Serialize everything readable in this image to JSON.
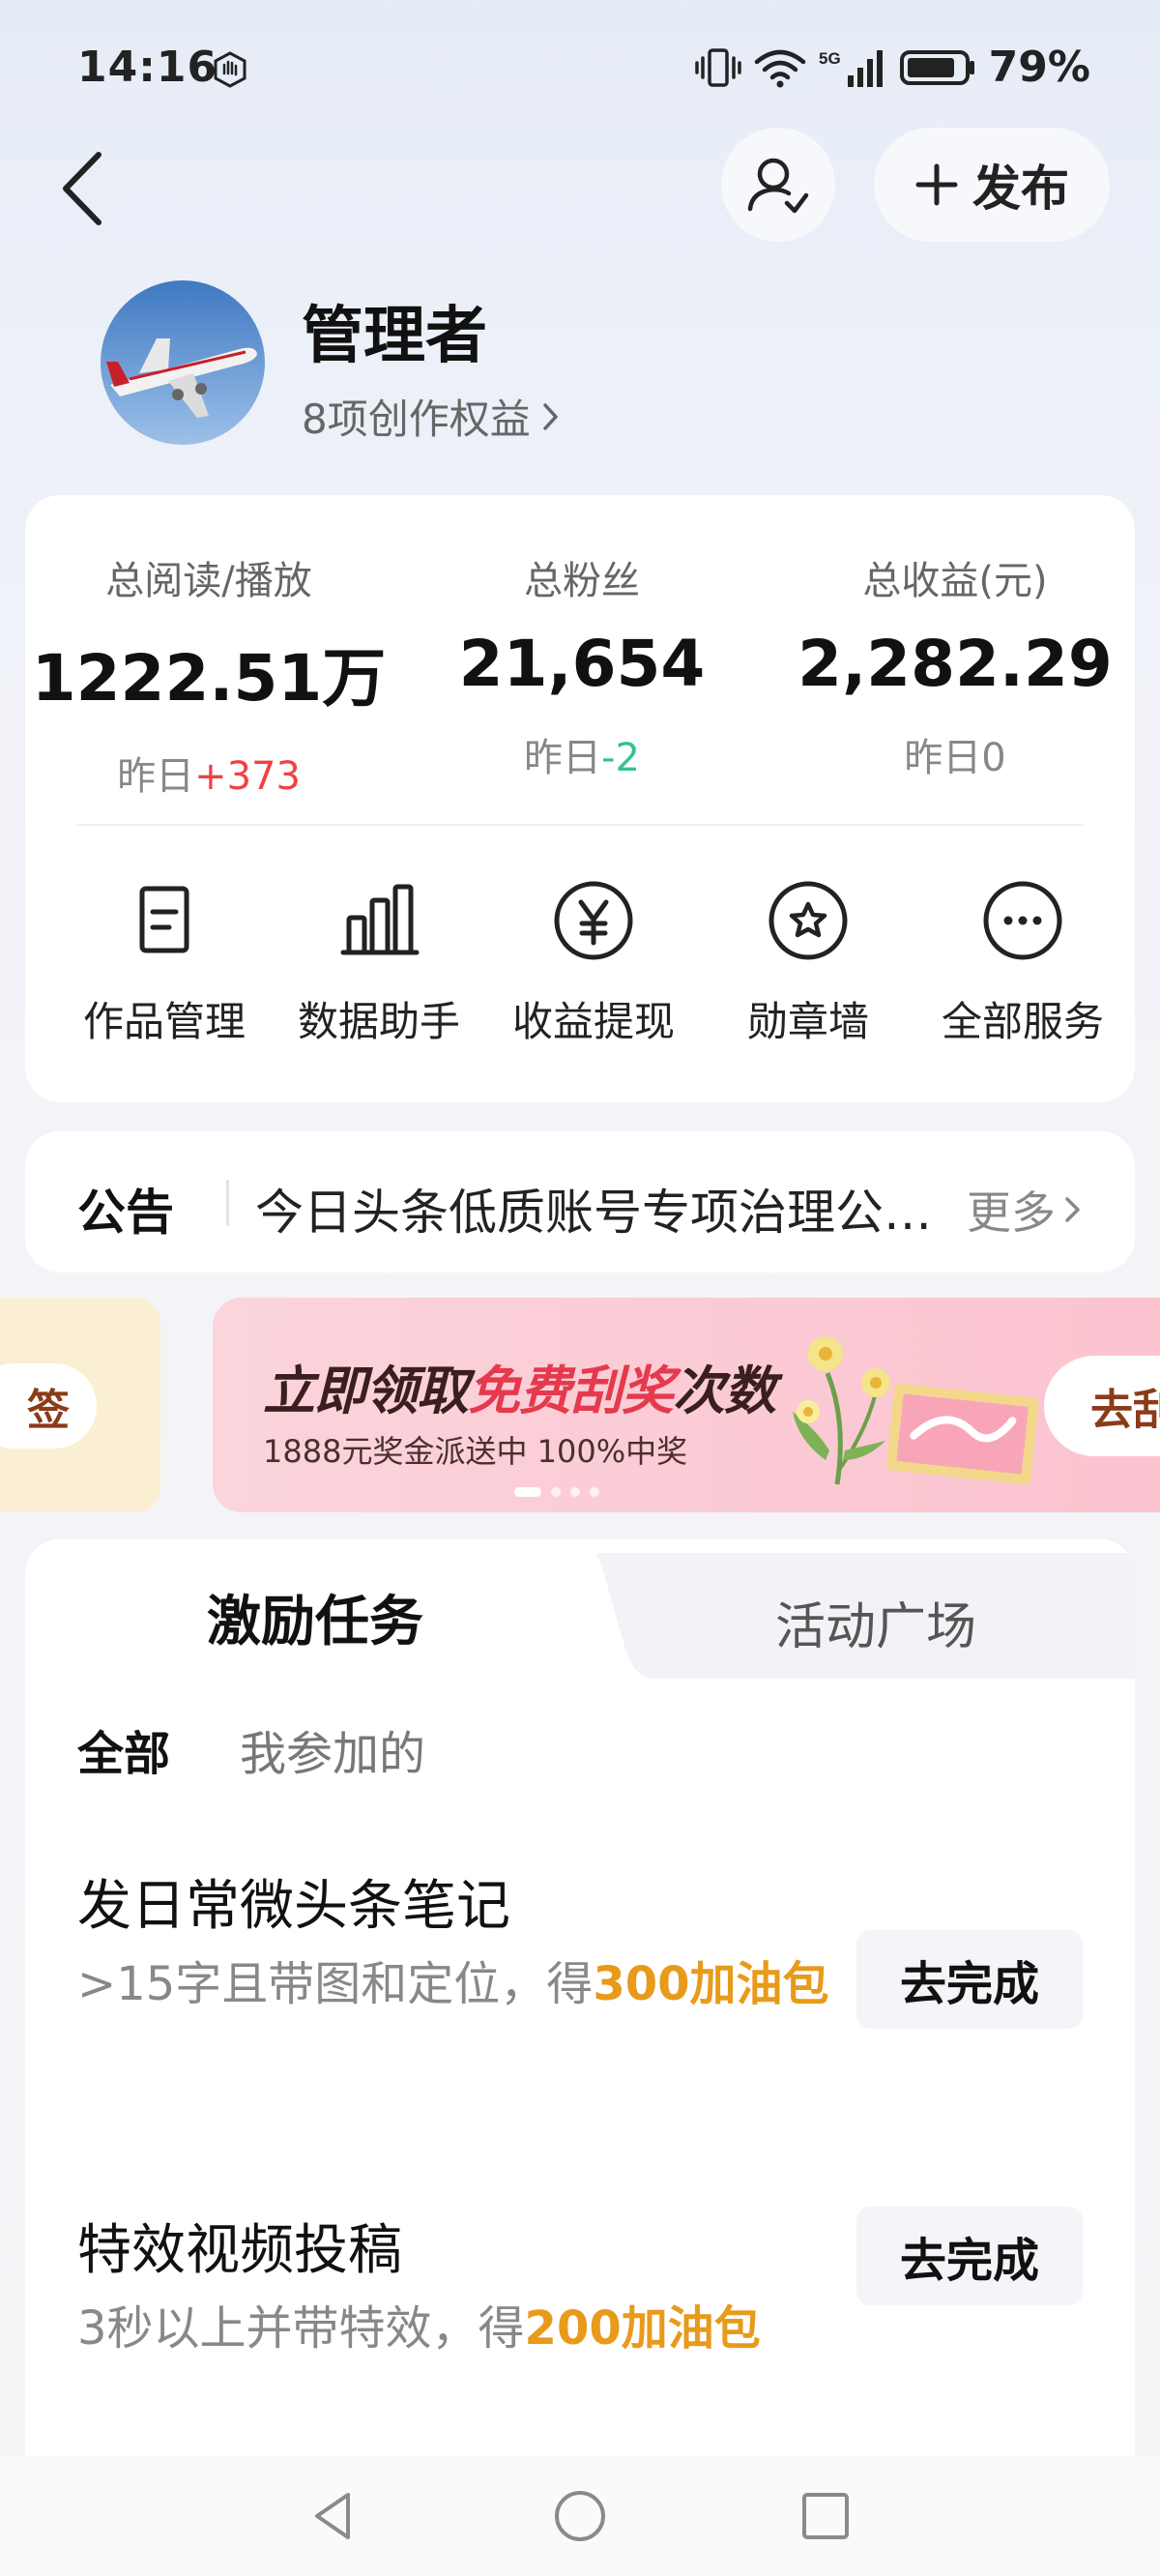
{
  "status_bar": {
    "time": "14:16",
    "battery": "79%",
    "network": "5G",
    "icons": [
      "hand-icon",
      "vibrate-icon",
      "wifi-icon",
      "signal-icon",
      "battery-icon"
    ]
  },
  "header": {
    "back_icon": "chevron-left-icon",
    "profile_icon": "user-check-icon",
    "publish_label": "发布"
  },
  "profile": {
    "name": "管理者",
    "rights_text": "8项创作权益"
  },
  "stats": [
    {
      "label": "总阅读/播放",
      "value": "1222.51万",
      "sub_prefix": "昨日",
      "sub_change": "+373",
      "trend": "up"
    },
    {
      "label": "总粉丝",
      "value": "21,654",
      "sub_prefix": "昨日",
      "sub_change": "-2",
      "trend": "down"
    },
    {
      "label": "总收益(元)",
      "value": "2,282.29",
      "sub_prefix": "昨日",
      "sub_change": "0",
      "trend": "flat"
    }
  ],
  "services": [
    {
      "label": "作品管理",
      "icon": "document-icon"
    },
    {
      "label": "数据助手",
      "icon": "bar-chart-icon"
    },
    {
      "label": "收益提现",
      "icon": "yuan-icon"
    },
    {
      "label": "勋章墙",
      "icon": "medal-icon"
    },
    {
      "label": "全部服务",
      "icon": "more-icon"
    }
  ],
  "notice": {
    "label": "公告",
    "text": "今日头条低质账号专项治理公…",
    "more": "更多"
  },
  "banners": {
    "left_button": "签",
    "title_pre": "立即领取",
    "title_highlight": "免费刮奖",
    "title_post": "次数",
    "subtitle": "1888元奖金派送中 100%中奖",
    "cta": "去刮",
    "dot_count": 4,
    "active_dot": 0
  },
  "tasks_tabs": {
    "active": "激励任务",
    "inactive": "活动广场"
  },
  "filters": {
    "all": "全部",
    "mine": "我参加的"
  },
  "tasks": [
    {
      "title": "发日常微头条笔记",
      "desc_pre": ">15字且带图和定位，得",
      "reward": "300加油包",
      "button": "去完成"
    },
    {
      "title": "特效视频投稿",
      "desc_pre": "3秒以上并带特效，得",
      "reward": "200加油包",
      "button": "去完成"
    }
  ],
  "colors": {
    "up": "#f04142",
    "down": "#35c28b",
    "reward": "#e89a1a",
    "banner_accent": "#e53a4e"
  }
}
